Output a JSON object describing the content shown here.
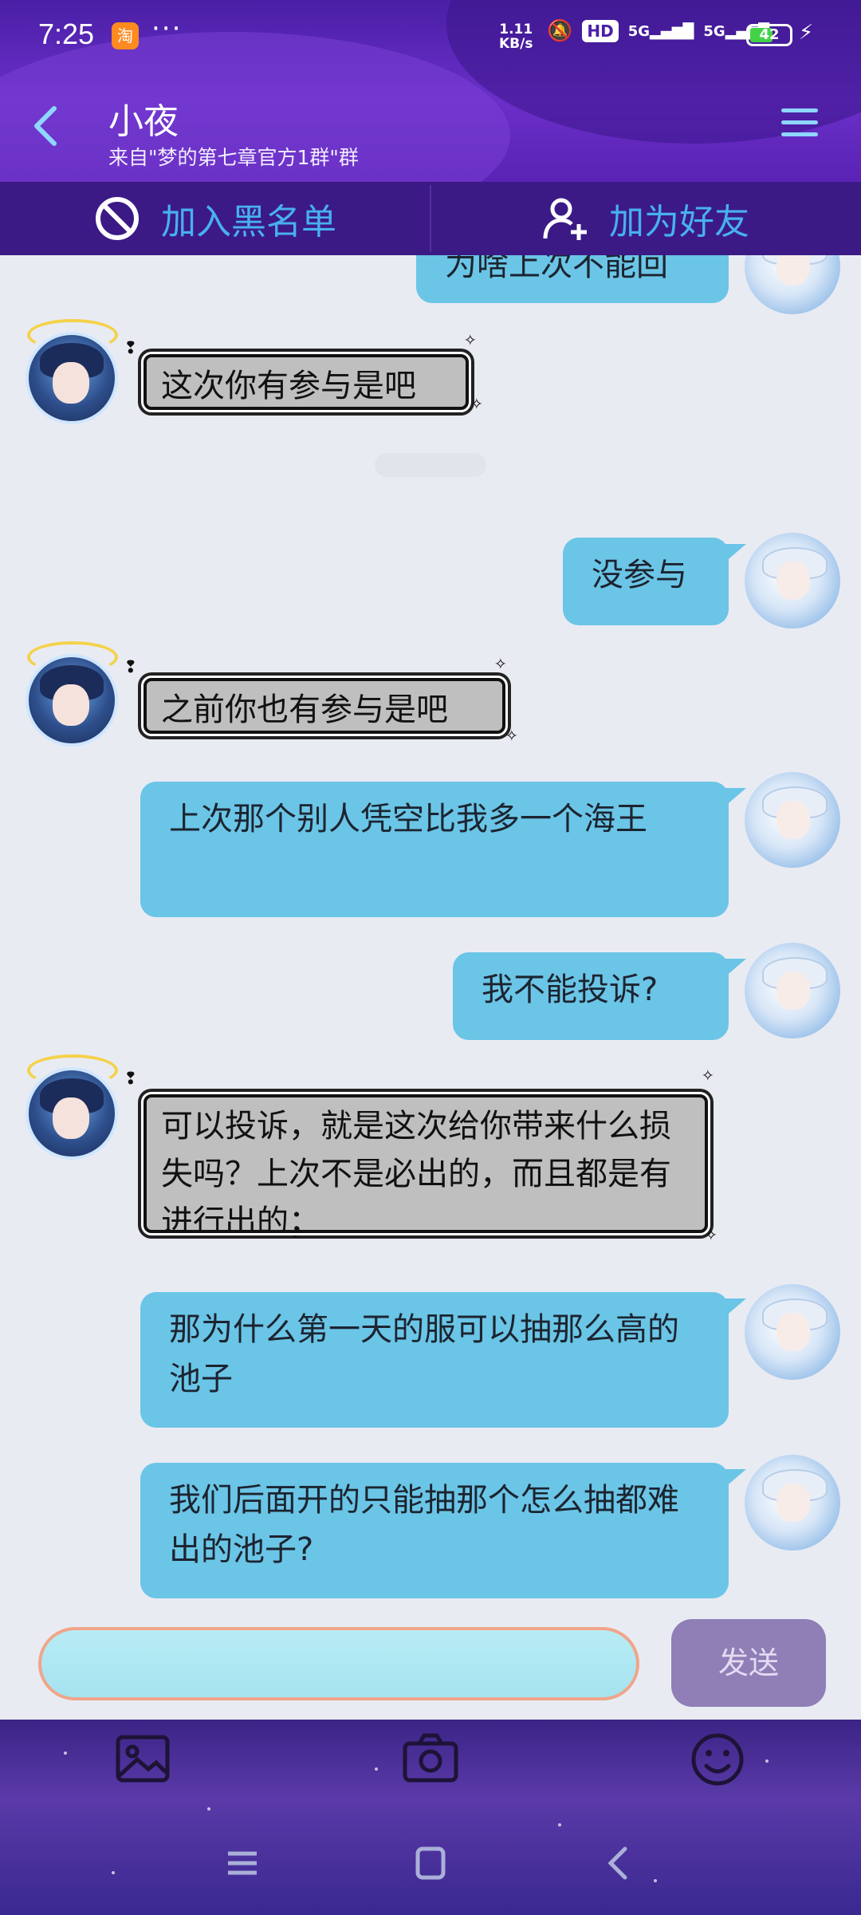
{
  "status_bar": {
    "time": "7:25",
    "dots": "···",
    "net_speed_value": "1.11",
    "net_speed_unit": "KB/s",
    "hd_label": "HD",
    "network_1": "5G",
    "network_2": "5G",
    "battery": "42"
  },
  "header": {
    "title": "小夜",
    "subtitle": "来自\"梦的第七章官方1群\"群"
  },
  "actions": {
    "blacklist_label": "加入黑名单",
    "add_friend_label": "加为好友"
  },
  "messages": [
    {
      "side": "right",
      "text": "为啥上次不能回"
    },
    {
      "side": "left",
      "text": "这次你有参与是吧"
    },
    {
      "side": "right",
      "text": "没参与"
    },
    {
      "side": "left",
      "text": "之前你也有参与是吧"
    },
    {
      "side": "right",
      "text": "上次那个别人凭空比我多一个海王"
    },
    {
      "side": "right",
      "text": "我不能投诉?"
    },
    {
      "side": "left",
      "text": "可以投诉，就是这次给你带来什么损失吗？上次不是必出的，而且都是有进行出的；"
    },
    {
      "side": "right",
      "text": "那为什么第一天的服可以抽那么高的池子"
    },
    {
      "side": "right",
      "text": "我们后面开的只能抽那个怎么抽都难出的池子?"
    }
  ],
  "input": {
    "placeholder": "",
    "send_label": "发送"
  },
  "colors": {
    "header_purple": "#5a22b4",
    "action_blue": "#48b0f0",
    "bubble_blue": "#6bc5e6",
    "bubble_gray": "#bfbfbf",
    "send_button": "#8f7fb6"
  },
  "icons": {
    "back": "chevron-left-icon",
    "menu": "hamburger-menu-icon",
    "blacklist": "block-icon",
    "add_friend": "add-person-icon",
    "image": "image-icon",
    "camera": "camera-icon",
    "emoji": "emoji-icon"
  }
}
